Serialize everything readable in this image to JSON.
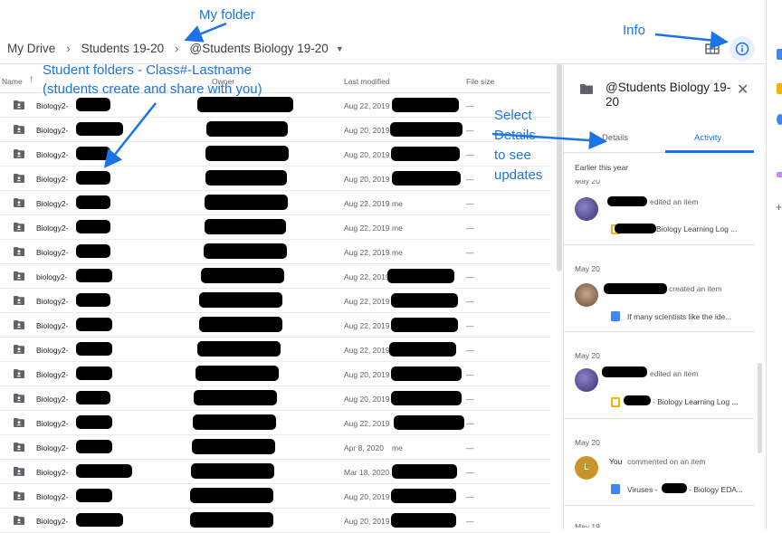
{
  "breadcrumb": {
    "root": "My Drive",
    "parent": "Students 19-20",
    "current": "@Students Biology 19-20"
  },
  "list": {
    "headers": {
      "name": "Name",
      "owner": "Owner",
      "last_modified": "Last modified",
      "file_size": "File size"
    },
    "rows": [
      {
        "name": "Biology2-",
        "date": "Aug 22, 2019",
        "owner_text": "",
        "size": "—"
      },
      {
        "name": "Biology2-",
        "date": "Aug 20, 2019",
        "owner_text": "",
        "size": "—"
      },
      {
        "name": "Biology2-",
        "date": "Aug 20, 2019",
        "owner_text": "",
        "size": "—"
      },
      {
        "name": "Biology2-",
        "date": "Aug 20, 2019",
        "owner_text": "",
        "size": "—"
      },
      {
        "name": "Biology2-",
        "date": "Aug 22, 2019",
        "owner_text": "me",
        "size": "—"
      },
      {
        "name": "Biology2-",
        "date": "Aug 22, 2019",
        "owner_text": "me",
        "size": "—"
      },
      {
        "name": "Biology2-",
        "date": "Aug 22, 2019",
        "owner_text": "me",
        "size": "—"
      },
      {
        "name": "biology2-",
        "date": "Aug 22, 2019",
        "owner_text": "",
        "size": "—"
      },
      {
        "name": "Biology2-",
        "date": "Aug 22, 2019",
        "owner_text": "",
        "size": "—"
      },
      {
        "name": "Biology2-",
        "date": "Aug 22, 2019",
        "owner_text": "",
        "size": "—"
      },
      {
        "name": "Biology2-",
        "date": "Aug 22, 2019",
        "owner_text": "",
        "size": "—"
      },
      {
        "name": "Biology2-",
        "date": "Aug 20, 2019",
        "owner_text": "",
        "size": "—"
      },
      {
        "name": "Biology2-",
        "date": "Aug 20, 2019",
        "owner_text": "",
        "size": "—"
      },
      {
        "name": "Biology2-",
        "date": "Aug 22, 2019",
        "owner_text": "",
        "size": "—"
      },
      {
        "name": "Biology2-",
        "date": "Apr 8, 2020",
        "owner_text": "me",
        "size": "—"
      },
      {
        "name": "Biology2-",
        "date": "Mar 18, 2020",
        "owner_text": "",
        "size": "—"
      },
      {
        "name": "Biology2-",
        "date": "Aug 20, 2019",
        "owner_text": "",
        "size": "—"
      },
      {
        "name": "Biology2-",
        "date": "Aug 20, 2019",
        "owner_text": "",
        "size": "—"
      }
    ]
  },
  "panel": {
    "title": "@Students Biology 19-20",
    "tabs": {
      "details": "Details",
      "activity": "Activity"
    },
    "section": "Earlier this year",
    "activity": [
      {
        "date": "May 20",
        "action": "edited an item",
        "doc": "Biology Learning Log ...",
        "doc_color": "#f4b400"
      },
      {
        "date": "May 20",
        "action": "created an item",
        "doc": "If many scientists like the ide...",
        "doc_color": "#4285f4"
      },
      {
        "date": "May 20",
        "action": "edited an item",
        "doc": "- Biology Learning Log ...",
        "doc_color": "#f4b400"
      },
      {
        "date": "May 20",
        "actor": "You",
        "action": "commented on an item",
        "doc": "Viruses - ",
        "doc_suffix": "- Biology EDA...",
        "avatar_letter": "L",
        "doc_color": "#4285f4"
      }
    ],
    "next_date": "May 19"
  },
  "annotations": {
    "my_folder": "My folder",
    "info": "Info",
    "student_folders_line1": "Student folders - Class#-Lastname",
    "student_folders_line2": "(students create and share with you)",
    "select_details": [
      "Select",
      "Details",
      "to see",
      "updates"
    ]
  },
  "colors": {
    "accent": "#1a73e8",
    "annotation": "#1a73e8",
    "info_bg": "#e8f0fe"
  }
}
